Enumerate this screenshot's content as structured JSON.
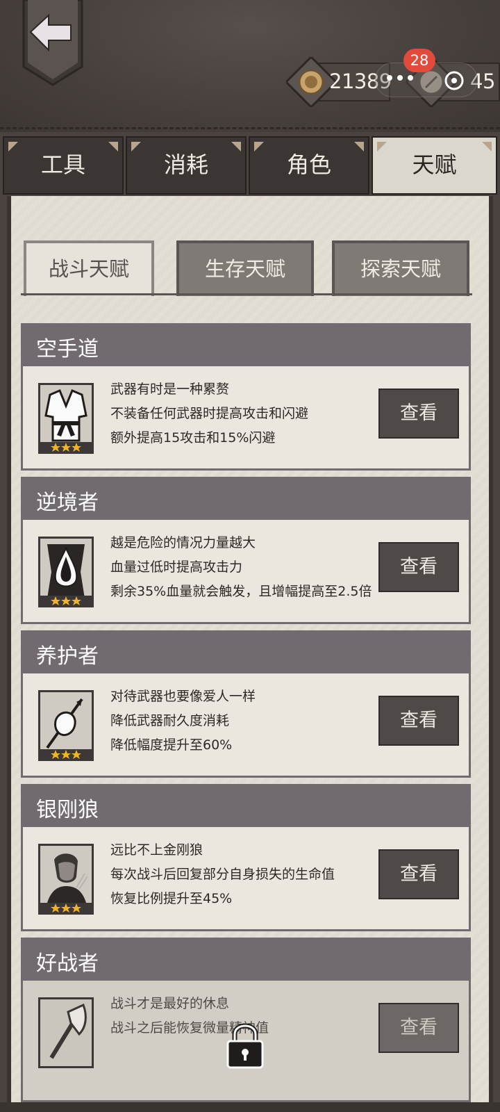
{
  "header": {
    "currency_coins": "21389",
    "currency_secondary": "45",
    "notification_count": "28"
  },
  "main_tabs": [
    {
      "label": "工具",
      "active": false
    },
    {
      "label": "消耗",
      "active": false
    },
    {
      "label": "角色",
      "active": false
    },
    {
      "label": "天赋",
      "active": true
    }
  ],
  "sub_tabs": [
    {
      "label": "战斗天赋",
      "active": true
    },
    {
      "label": "生存天赋",
      "active": false
    },
    {
      "label": "探索天赋",
      "active": false
    }
  ],
  "talents": [
    {
      "name": "空手道",
      "icon": "karate-gi-icon",
      "stars": 3,
      "lines": [
        "武器有时是一种累赘",
        "不装备任何武器时提高攻击和闪避",
        "额外提高15攻击和15%闪避"
      ],
      "button": "查看",
      "locked": false
    },
    {
      "name": "逆境者",
      "icon": "blood-drop-icon",
      "stars": 3,
      "lines": [
        "越是危险的情况力量越大",
        "血量过低时提高攻击力",
        "剩余35%血量就会触发，且增幅提高至2.5倍"
      ],
      "button": "查看",
      "locked": false
    },
    {
      "name": "养护者",
      "icon": "spear-care-icon",
      "stars": 3,
      "lines": [
        "对待武器也要像爱人一样",
        "降低武器耐久度消耗",
        "降低幅度提升至60%"
      ],
      "button": "查看",
      "locked": false
    },
    {
      "name": "银刚狼",
      "icon": "wolverine-portrait-icon",
      "stars": 3,
      "lines": [
        "远比不上金刚狼",
        "每次战斗后回复部分自身损失的生命值",
        "恢复比例提升至45%"
      ],
      "button": "查看",
      "locked": false
    },
    {
      "name": "好战者",
      "icon": "axe-icon",
      "stars": 0,
      "lines": [
        "战斗才是最好的休息",
        "战斗之后能恢复微量精神值"
      ],
      "button": "查看",
      "locked": true
    }
  ],
  "colors": {
    "header_bar": "#716a70",
    "button": "#4f4a48",
    "star": "#f0b429",
    "badge": "#e24a3c"
  }
}
